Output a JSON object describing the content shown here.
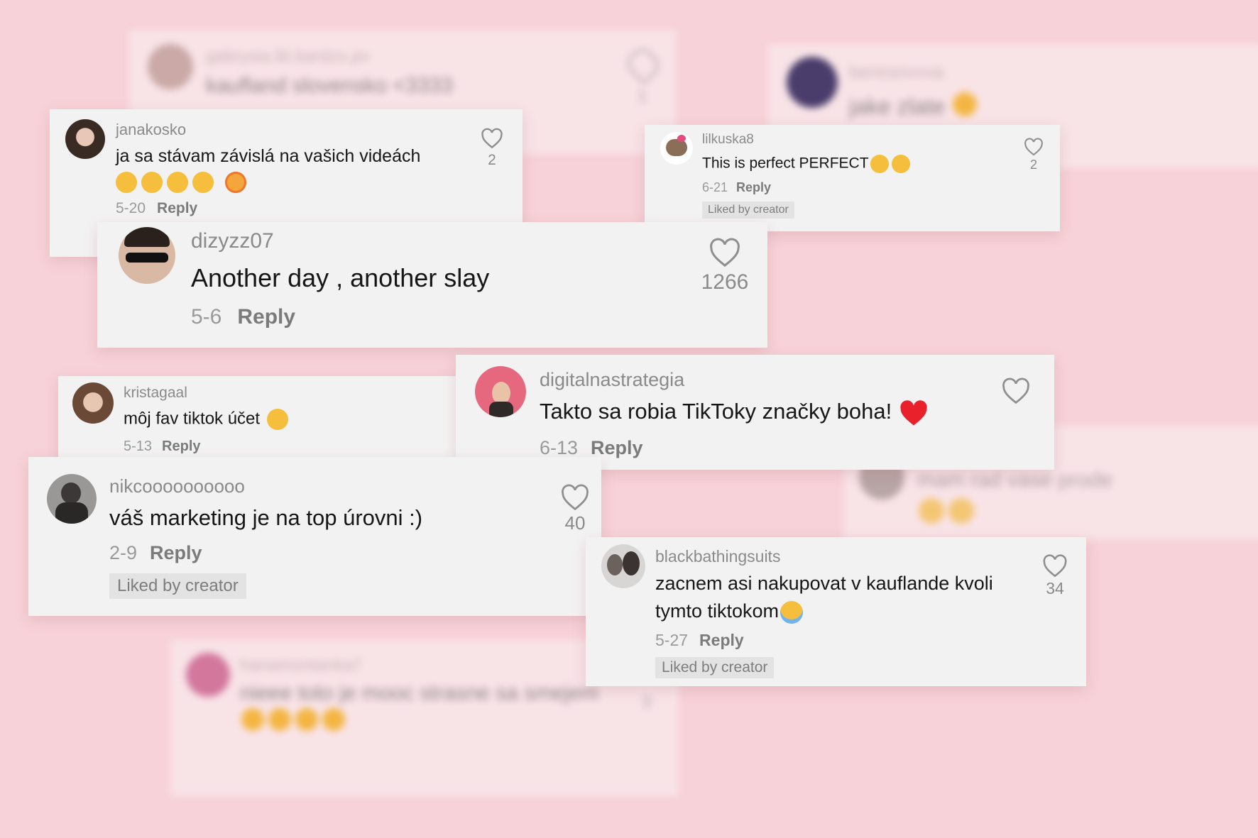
{
  "background_blurred": [
    {
      "user": "gabrysia.lili.bardzo.pv",
      "text": "kaufland slovensko <3333",
      "likes": "1"
    },
    {
      "user": "beresovvva",
      "text": "jake zlate"
    },
    {
      "user": "hanamontanka7",
      "text": "nieee toto je mooc strasne sa smejem",
      "likes": "3"
    },
    {
      "user": "",
      "text": "mam rad vase prode"
    }
  ],
  "comments": [
    {
      "user": "janakosko",
      "text": "ja sa stávam závislá na vašich videách",
      "date": "5-20",
      "reply": "Reply",
      "likes": "2"
    },
    {
      "user": "lilkuska8",
      "text": "This is perfect PERFECT",
      "date": "6-21",
      "reply": "Reply",
      "likes": "2",
      "badge": "Liked by creator"
    },
    {
      "user": "dizyzz07",
      "text": "Another day , another slay",
      "date": "5-6",
      "reply": "Reply",
      "likes": "1266"
    },
    {
      "user": "kristagaal",
      "text": "môj fav tiktok účet",
      "date": "5-13",
      "reply": "Reply"
    },
    {
      "user": "digitalnastrategia",
      "text": "Takto sa robia TikToky značky boha!",
      "date": "6-13",
      "reply": "Reply"
    },
    {
      "user": "nikcoooooooooo",
      "text": "váš marketing je na top úrovni :)",
      "date": "2-9",
      "reply": "Reply",
      "likes": "40",
      "badge": "Liked by creator"
    },
    {
      "user": "blackbathingsuits",
      "text": "zacnem asi nakupovat v kauflande kvoli",
      "text2": "tymto tiktokom",
      "date": "5-27",
      "reply": "Reply",
      "likes": "34",
      "badge": "Liked by creator"
    }
  ],
  "icons": [
    "heart-outline-icon",
    "laughing-emoji",
    "smiling-hearts-emoji",
    "star-struck-emoji",
    "grinning-emoji",
    "winking-tongue-emoji",
    "red-heart-emoji",
    "crying-emoji"
  ],
  "colors": {
    "background": "#f7d2d8",
    "card": "#f3f2f2",
    "text": "#161616",
    "muted": "#8a8a8a"
  }
}
